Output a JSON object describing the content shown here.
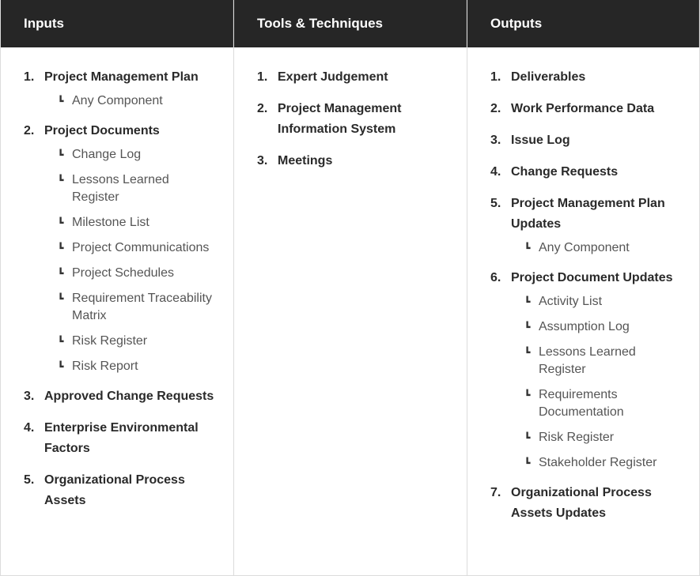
{
  "columns": [
    {
      "header": "Inputs",
      "items": [
        {
          "num": "1.",
          "title": "Project Management Plan",
          "subs": [
            "Any Component"
          ]
        },
        {
          "num": "2.",
          "title": "Project Documents",
          "subs": [
            "Change Log",
            "Lessons Learned Register",
            "Milestone List",
            "Project Communications",
            "Project Schedules",
            "Requirement Traceability Matrix",
            "Risk Register",
            "Risk Report"
          ]
        },
        {
          "num": "3.",
          "title": "Approved Change Requests",
          "subs": []
        },
        {
          "num": "4.",
          "title": "Enterprise Environmental Factors",
          "subs": []
        },
        {
          "num": "5.",
          "title": "Organizational Process Assets",
          "subs": []
        }
      ]
    },
    {
      "header": "Tools & Techniques",
      "items": [
        {
          "num": "1.",
          "title": "Expert Judgement",
          "subs": []
        },
        {
          "num": "2.",
          "title": "Project Management Information System",
          "subs": []
        },
        {
          "num": "3.",
          "title": "Meetings",
          "subs": []
        }
      ]
    },
    {
      "header": "Outputs",
      "items": [
        {
          "num": "1.",
          "title": "Deliverables",
          "subs": []
        },
        {
          "num": "2.",
          "title": "Work Performance Data",
          "subs": []
        },
        {
          "num": "3.",
          "title": "Issue Log",
          "subs": []
        },
        {
          "num": "4.",
          "title": "Change Requests",
          "subs": []
        },
        {
          "num": "5.",
          "title": "Project Management Plan Updates",
          "subs": [
            "Any Component"
          ]
        },
        {
          "num": "6.",
          "title": "Project Document Updates",
          "subs": [
            "Activity List",
            "Assumption Log",
            "Lessons Learned Register",
            "Requirements Documentation",
            "Risk Register",
            "Stakeholder Register"
          ]
        },
        {
          "num": "7.",
          "title": "Organizational Process Assets Updates",
          "subs": []
        }
      ]
    }
  ],
  "sub_icon": "corner-arrow-icon",
  "sub_glyph": "┗"
}
